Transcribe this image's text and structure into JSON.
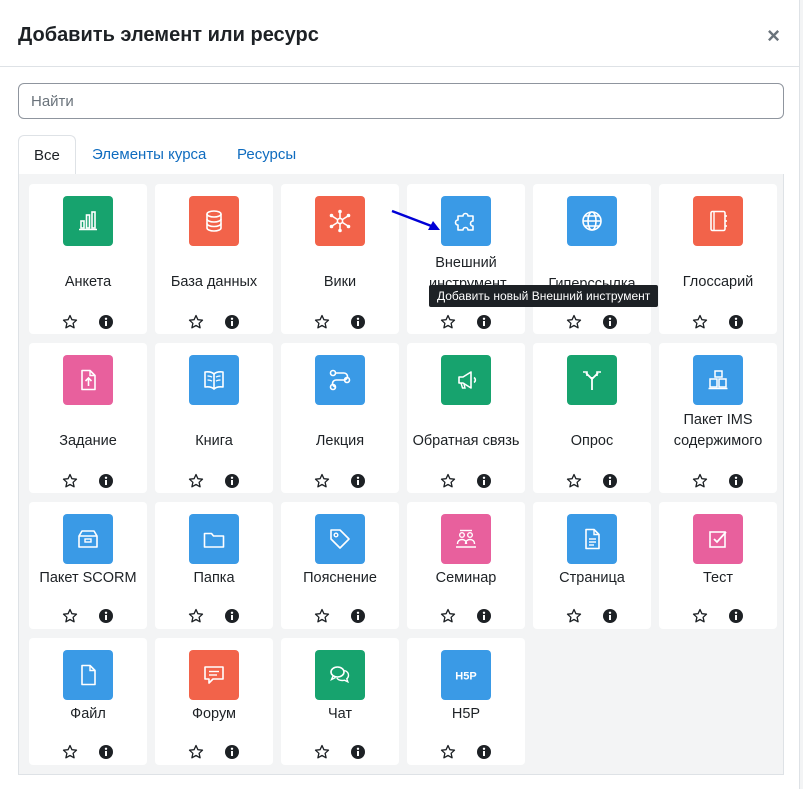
{
  "modal": {
    "title": "Добавить элемент или ресурс",
    "close": "×"
  },
  "search": {
    "placeholder": "Найти",
    "value": ""
  },
  "tabs": [
    {
      "label": "Все",
      "active": true
    },
    {
      "label": "Элементы курса",
      "active": false
    },
    {
      "label": "Ресурсы",
      "active": false
    }
  ],
  "tooltip": "Добавить новый Внешний инструмент",
  "colors": {
    "green": "#17a36e",
    "red": "#f2634a",
    "blue": "#3a9ae6",
    "pink": "#e8609d",
    "star": "#1d2125",
    "info": "#1d2125",
    "link": "#0f6cbf",
    "arrow": "#0000d6"
  },
  "items": [
    {
      "label": "Анкета",
      "icon": "bar-chart-icon",
      "color": "green"
    },
    {
      "label": "База данных",
      "icon": "database-icon",
      "color": "red"
    },
    {
      "label": "Вики",
      "icon": "network-icon",
      "color": "red"
    },
    {
      "label": "Внешний инструмент",
      "icon": "puzzle-icon",
      "color": "blue"
    },
    {
      "label": "Гиперссылка",
      "icon": "globe-icon",
      "color": "blue"
    },
    {
      "label": "Глоссарий",
      "icon": "address-book-icon",
      "color": "red"
    },
    {
      "label": "Задание",
      "icon": "file-upload-icon",
      "color": "pink"
    },
    {
      "label": "Книга",
      "icon": "book-icon",
      "color": "blue"
    },
    {
      "label": "Лекция",
      "icon": "route-icon",
      "color": "blue"
    },
    {
      "label": "Обратная связь",
      "icon": "megaphone-icon",
      "color": "green"
    },
    {
      "label": "Опрос",
      "icon": "signpost-icon",
      "color": "green"
    },
    {
      "label": "Пакет IMS содержимого",
      "icon": "cubes-icon",
      "color": "blue"
    },
    {
      "label": "Пакет SCORM",
      "icon": "box-icon",
      "color": "blue"
    },
    {
      "label": "Папка",
      "icon": "folder-icon",
      "color": "blue"
    },
    {
      "label": "Пояснение",
      "icon": "tag-icon",
      "color": "blue"
    },
    {
      "label": "Семинар",
      "icon": "workshop-icon",
      "color": "pink"
    },
    {
      "label": "Страница",
      "icon": "document-icon",
      "color": "blue"
    },
    {
      "label": "Тест",
      "icon": "checkbox-icon",
      "color": "pink"
    },
    {
      "label": "Файл",
      "icon": "file-icon",
      "color": "blue"
    },
    {
      "label": "Форум",
      "icon": "comment-icon",
      "color": "red"
    },
    {
      "label": "Чат",
      "icon": "chat-bubbles-icon",
      "color": "green"
    },
    {
      "label": "H5P",
      "icon": "h5p-icon",
      "color": "blue"
    }
  ]
}
